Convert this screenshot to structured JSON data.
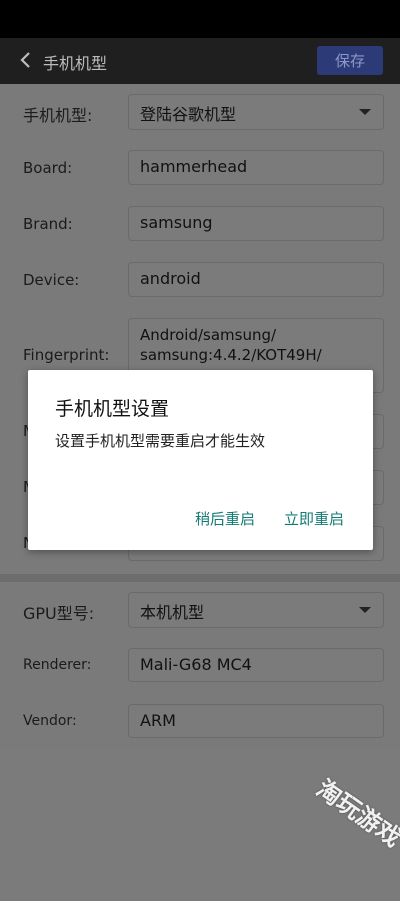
{
  "app_bar": {
    "title": "手机机型",
    "save_label": "保存"
  },
  "phone_model": {
    "label": "手机机型:",
    "value": "登陆谷歌机型"
  },
  "board": {
    "label": "Board:",
    "value": "hammerhead"
  },
  "brand": {
    "label": "Brand:",
    "value": "samsung"
  },
  "device": {
    "label": "Device:",
    "value": "android"
  },
  "fingerprint": {
    "label": "Fingerprint:",
    "line1": "Android/samsung/",
    "line2": "samsung:4.4.2/KOT49H/"
  },
  "partial_rows": [
    {
      "label": "M"
    },
    {
      "label": "M"
    },
    {
      "label": "N"
    }
  ],
  "gpu": {
    "label": "GPU型号:",
    "value": "本机机型"
  },
  "renderer": {
    "label": "Renderer:",
    "value": "Mali-G68 MC4"
  },
  "vendor": {
    "label": "Vendor:",
    "value": "ARM"
  },
  "dialog": {
    "title": "手机机型设置",
    "message": "设置手机机型需要重启才能生效",
    "later_label": "稍后重启",
    "now_label": "立即重启"
  },
  "watermark": "淘玩游戏",
  "colors": {
    "dialog_button": "#127b73",
    "save_button_bg": "#2c3a78"
  }
}
